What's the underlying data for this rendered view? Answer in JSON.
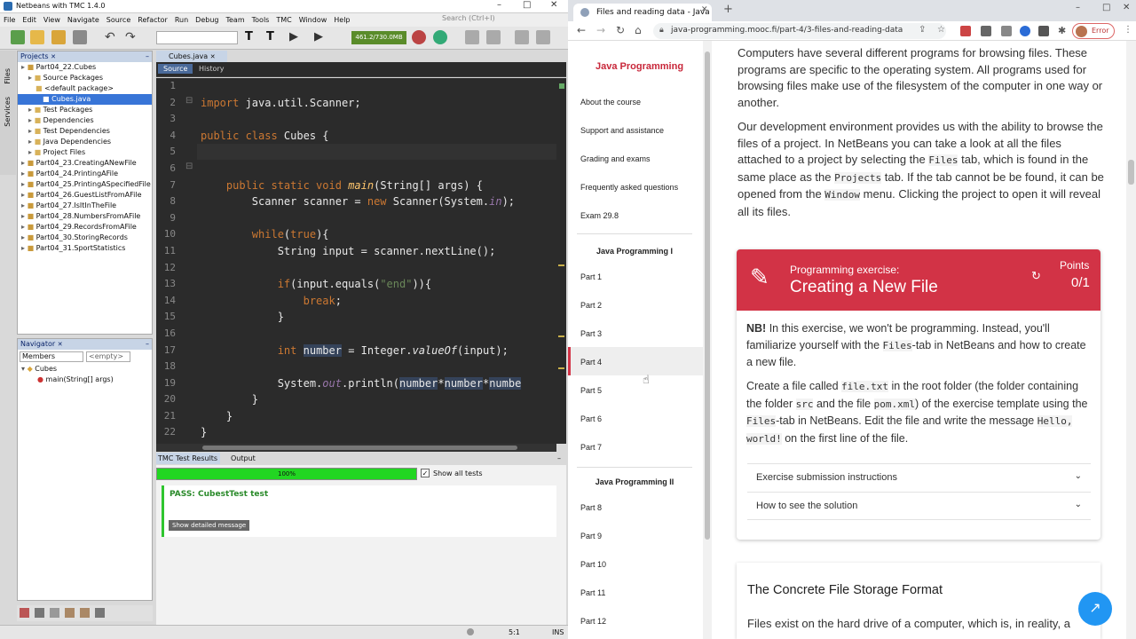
{
  "netbeans": {
    "title": "Netbeans with TMC 1.4.0",
    "menu": [
      "File",
      "Edit",
      "View",
      "Navigate",
      "Source",
      "Refactor",
      "Run",
      "Debug",
      "Team",
      "Tools",
      "TMC",
      "Window",
      "Help"
    ],
    "search_placeholder": "Search (Ctrl+I)",
    "memory": "461.2/730.0MB",
    "projects_tab": "Projects",
    "files_side": "Files",
    "services_side": "Services",
    "project_tree": [
      "Part04_22.Cubes",
      "Source Packages",
      "<default package>",
      "Cubes.java",
      "Test Packages",
      "Dependencies",
      "Test Dependencies",
      "Java Dependencies",
      "Project Files",
      "Part04_23.CreatingANewFile",
      "Part04_24.PrintingAFile",
      "Part04_25.PrintingASpecifiedFile",
      "Part04_26.GuestListFromAFile",
      "Part04_27.IsItInTheFile",
      "Part04_28.NumbersFromAFile",
      "Part04_29.RecordsFromAFile",
      "Part04_30.StoringRecords",
      "Part04_31.SportStatistics"
    ],
    "navigator_tab": "Navigator",
    "members_label": "Members",
    "empty_label": "<empty>",
    "nav_tree": [
      "Cubes",
      "main(String[] args)"
    ],
    "editor_tab": "Cubes.java",
    "source_tab": "Source",
    "history_tab": "History",
    "line_numbers": [
      "1",
      "2",
      "3",
      "4",
      "5",
      "6",
      "7",
      "8",
      "9",
      "10",
      "11",
      "12",
      "13",
      "14",
      "15",
      "16",
      "17",
      "18",
      "19",
      "20",
      "21",
      "22"
    ],
    "tmc_tab": "TMC Test Results",
    "output_tab": "Output",
    "progress_label": "100%",
    "progress": 1.0,
    "show_all_tests": "Show all tests",
    "pass_text": "PASS: CubestTest test",
    "detail_button": "Show detailed message",
    "caret_pos": "5:1",
    "ins_mode": "INS"
  },
  "browser": {
    "tab_title": "Files and reading data - Java Pro",
    "url": "java-programming.mooc.fi/part-4/3-files-and-reading-data",
    "error_badge": "Error",
    "sidebar": {
      "brand": "Java Programming",
      "links": [
        "About the course",
        "Support and assistance",
        "Grading and exams",
        "Frequently asked questions",
        "Exam 29.8"
      ],
      "section1": "Java Programming I",
      "parts1": [
        "Part 1",
        "Part 2",
        "Part 3",
        "Part 4",
        "Part 5",
        "Part 6",
        "Part 7"
      ],
      "section2": "Java Programming II",
      "parts2": [
        "Part 8",
        "Part 9",
        "Part 10",
        "Part 11",
        "Part 12"
      ]
    },
    "p1": "Computers have several different programs for browsing files. These programs are specific to the operating system. All programs used for browsing files make use of the filesystem of the computer in one way or another.",
    "p2_a": "Our development environment provides us with the ability to browse the files of a project. In NetBeans you can take a look at all the files attached to a project by selecting the ",
    "p2_files": "Files",
    "p2_b": " tab, which is found in the same place as the ",
    "p2_projects": "Projects",
    "p2_c": " tab. If the tab cannot be be found, it can be opened from the ",
    "p2_window": "Window",
    "p2_d": " menu. Clicking the project to open it will reveal all its files.",
    "exercise": {
      "kicker": "Programming exercise:",
      "title": "Creating a New File",
      "points_label": "Points",
      "points": "0/1",
      "nb": "NB!",
      "nb_text": " In this exercise, we won't be programming. Instead, you'll familiarize yourself with the ",
      "nb_files": "Files",
      "nb_text2": "-tab in NetBeans and how to create a new file.",
      "c1": "Create a file called ",
      "c_file": "file.txt",
      "c2": " in the root folder (the folder containing the folder ",
      "c_src": "src",
      "c3": " and the file ",
      "c_pom": "pom.xml",
      "c4": ") of the exercise template using the ",
      "c_files": "Files",
      "c5": "-tab in NetBeans. Edit the file and write the message ",
      "c_msg": "Hello, world!",
      "c6": " on the first line of the file.",
      "acc1": "Exercise submission instructions",
      "acc2": "How to see the solution"
    },
    "h2": "The Concrete File Storage Format",
    "p3": "Files exist on the hard drive of a computer, which is, in reality, a"
  }
}
